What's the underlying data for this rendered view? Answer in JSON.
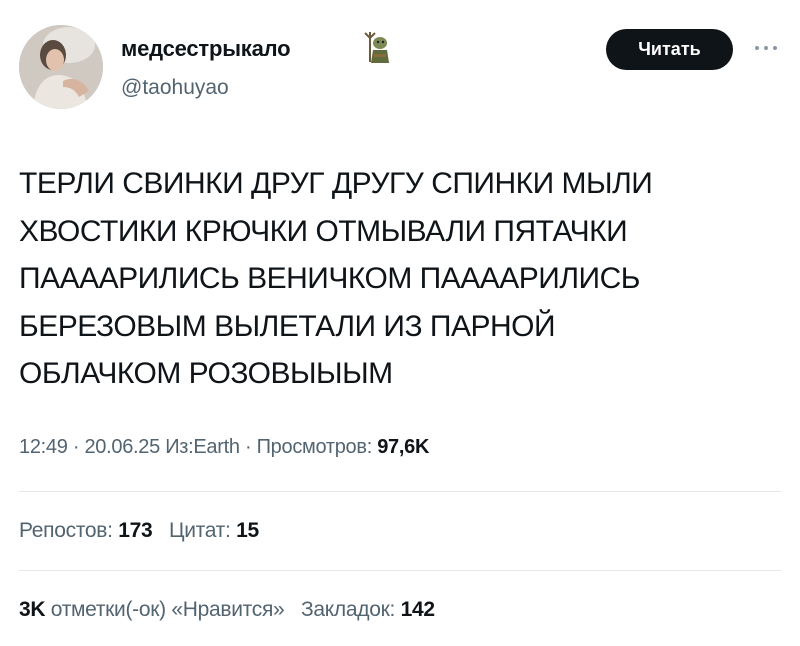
{
  "author": {
    "display_name": "медсестрыкало",
    "handle": "@taohuyao",
    "emoji_icon": "troll-icon"
  },
  "follow_label": "Читать",
  "tweet_lines": [
    "ТЕРЛИ СВИНКИ ДРУГ ДРУГУ СПИНКИ МЫЛИ",
    "ХВОСТИКИ КРЮЧКИ ОТМЫВАЛИ ПЯТАЧКИ",
    "ПААААРИЛИСЬ ВЕНИЧКОМ ПААААРИЛИСЬ",
    "БЕРЕЗОВЫМ ВЫЛЕТАЛИ ИЗ ПАРНОЙ",
    "ОБЛАЧКОМ РОЗОВЫЫЫМ"
  ],
  "meta": {
    "time": "12:49",
    "date": "20.06.25",
    "source": "Из:Earth",
    "views_label": "Просмотров:",
    "views": "97,6K",
    "sep": "·"
  },
  "stats": {
    "reposts_label": "Репостов:",
    "reposts": "173",
    "quotes_label": "Цитат:",
    "quotes": "15",
    "likes": "3K",
    "likes_label": "отметки(-ок) «Нравится»",
    "bookmarks_label": "Закладок:",
    "bookmarks": "142"
  },
  "colors": {
    "text": "#0f1419",
    "secondary": "#536471",
    "divider": "#e4e8eb",
    "button_bg": "#0f1419"
  }
}
